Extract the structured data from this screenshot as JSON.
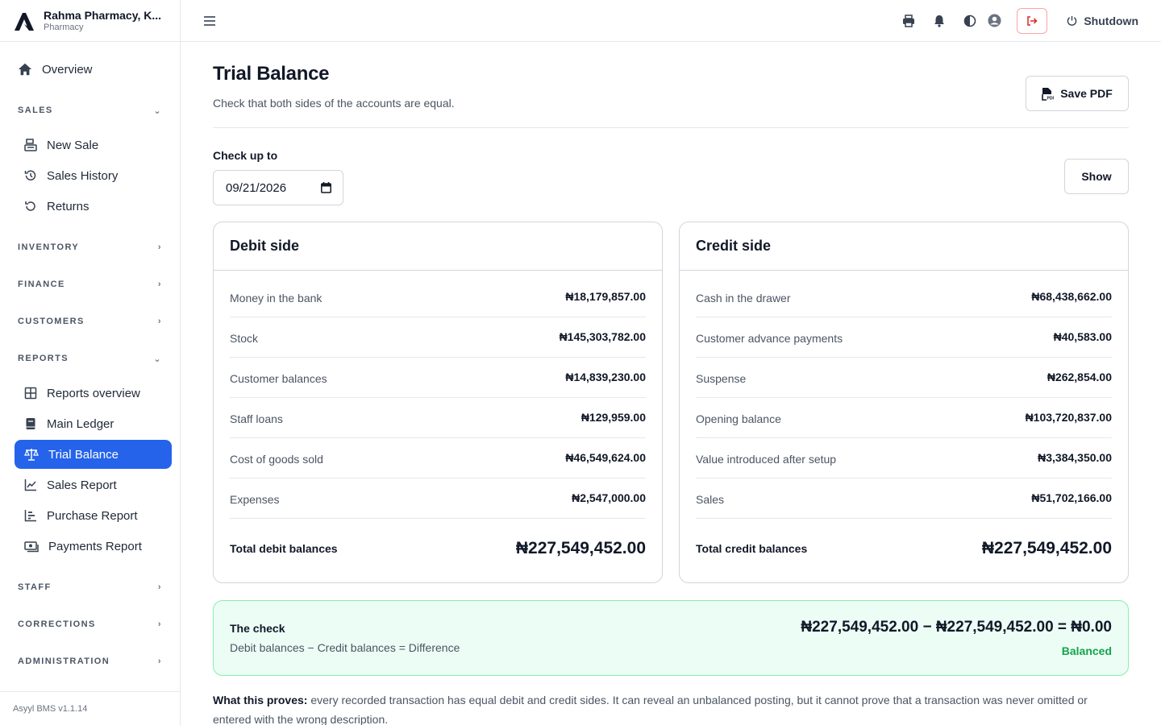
{
  "brand": {
    "name": "Rahma Pharmacy, K...",
    "subtitle": "Pharmacy"
  },
  "sidebar": {
    "overview": "Overview",
    "sections": {
      "sales": {
        "label": "SALES",
        "items": [
          "New Sale",
          "Sales History",
          "Returns"
        ]
      },
      "inventory": {
        "label": "INVENTORY"
      },
      "finance": {
        "label": "FINANCE"
      },
      "customers": {
        "label": "CUSTOMERS"
      },
      "reports": {
        "label": "REPORTS",
        "items": [
          "Reports overview",
          "Main Ledger",
          "Trial Balance",
          "Sales Report",
          "Purchase Report",
          "Payments Report"
        ]
      },
      "staff": {
        "label": "STAFF"
      },
      "corrections": {
        "label": "CORRECTIONS"
      },
      "administration": {
        "label": "ADMINISTRATION"
      }
    },
    "active_item": "Trial Balance",
    "version": "Asyyl BMS v1.1.14"
  },
  "topbar": {
    "shutdown_label": "Shutdown"
  },
  "page": {
    "title": "Trial Balance",
    "subtitle": "Check that both sides of the accounts are equal.",
    "save_pdf_label": "Save PDF",
    "filter_label": "Check up to",
    "date_value": "09/21/2026",
    "show_label": "Show"
  },
  "debit": {
    "title": "Debit side",
    "rows": [
      {
        "label": "Money in the bank",
        "value": "₦18,179,857.00"
      },
      {
        "label": "Stock",
        "value": "₦145,303,782.00"
      },
      {
        "label": "Customer balances",
        "value": "₦14,839,230.00"
      },
      {
        "label": "Staff loans",
        "value": "₦129,959.00"
      },
      {
        "label": "Cost of goods sold",
        "value": "₦46,549,624.00"
      },
      {
        "label": "Expenses",
        "value": "₦2,547,000.00"
      }
    ],
    "total_label": "Total debit balances",
    "total_value": "₦227,549,452.00"
  },
  "credit": {
    "title": "Credit side",
    "rows": [
      {
        "label": "Cash in the drawer",
        "value": "₦68,438,662.00"
      },
      {
        "label": "Customer advance payments",
        "value": "₦40,583.00"
      },
      {
        "label": "Suspense",
        "value": "₦262,854.00"
      },
      {
        "label": "Opening balance",
        "value": "₦103,720,837.00"
      },
      {
        "label": "Value introduced after setup",
        "value": "₦3,384,350.00"
      },
      {
        "label": "Sales",
        "value": "₦51,702,166.00"
      }
    ],
    "total_label": "Total credit balances",
    "total_value": "₦227,549,452.00"
  },
  "check": {
    "title": "The check",
    "formula": "Debit balances − Credit balances = Difference",
    "equation": "₦227,549,452.00 − ₦227,549,452.00 = ₦0.00",
    "status": "Balanced"
  },
  "proof": {
    "lead": "What this proves:",
    "text": " every recorded transaction has equal debit and credit sides. It can reveal an unbalanced posting, but it cannot prove that a transaction was never omitted or entered with the wrong description."
  },
  "colors": {
    "accent": "#2563eb",
    "success": "#16a34a",
    "success_bg": "#ecfdf5",
    "danger": "#dc2626"
  }
}
